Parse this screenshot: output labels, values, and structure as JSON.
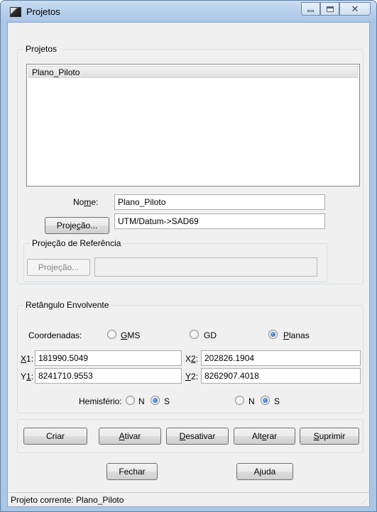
{
  "window": {
    "title": "Projetos"
  },
  "projetos_group": {
    "title": "Projetos",
    "items": [
      "Plano_Piloto"
    ],
    "nome_label": "Nome:",
    "nome_value": "Plano_Piloto",
    "projecao_button": "Projeção...",
    "projecao_value": "UTM/Datum->SAD69"
  },
  "referencia_group": {
    "title": "Projeção de Referência",
    "projecao_button": "Projeção...",
    "projecao_value": ""
  },
  "retangulo_group": {
    "title": "Retângulo Envolvente",
    "coordenadas_label": "Coordenadas:",
    "options": [
      {
        "label": "GMS",
        "checked": false
      },
      {
        "label": "GD",
        "checked": false
      },
      {
        "label": "Planas",
        "checked": true
      }
    ],
    "x1_label": "X1:",
    "x1_value": "181990.5049",
    "x2_label": "X2:",
    "x2_value": "202826.1904",
    "y1_label": "Y1:",
    "y1_value": "8241710.9553",
    "y2_label": "Y2:",
    "y2_value": "8262907.4018",
    "hemisferio_label": "Hemisfério:",
    "hemisferio1": {
      "n_label": "N",
      "s_label": "S",
      "selected": "S"
    },
    "hemisferio2": {
      "n_label": "N",
      "s_label": "S",
      "selected": "S"
    }
  },
  "actions": {
    "criar": "Criar",
    "ativar": "Ativar",
    "desativar": "Desativar",
    "alterar": "Alterar",
    "suprimir": "Suprimir"
  },
  "footer_buttons": {
    "fechar": "Fechar",
    "ajuda": "Ajuda"
  },
  "status": {
    "text": "Projeto corrente: Plano_Piloto"
  }
}
